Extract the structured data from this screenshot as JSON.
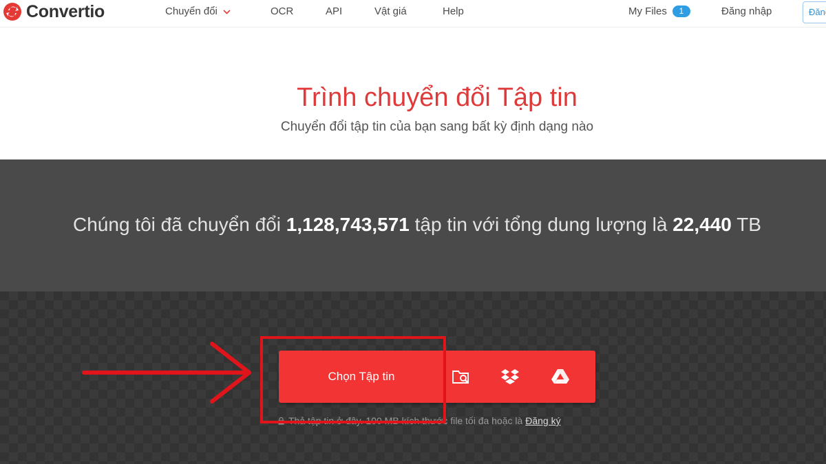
{
  "header": {
    "logo_text": "Convertio",
    "nav": [
      {
        "label": "Chuyển đổi",
        "has_dropdown": true
      },
      {
        "label": "OCR"
      },
      {
        "label": "API"
      },
      {
        "label": "Vật giá"
      },
      {
        "label": "Help"
      }
    ],
    "my_files_label": "My Files",
    "my_files_count": "1",
    "login_label": "Đăng nhập",
    "signup_label": "Đăng ký"
  },
  "hero": {
    "title": "Trình chuyển đổi Tập tin",
    "subtitle": "Chuyển đổi tập tin của bạn sang bất kỳ định dạng nào"
  },
  "stats": {
    "prefix": "Chúng tôi đã chuyển đổi",
    "files_count": "1,128,743,571",
    "middle": "tập tin với tổng dung lượng là",
    "total_size": "22,440",
    "unit": "TB"
  },
  "upload": {
    "choose_label": "Chọn Tập tin",
    "sources": [
      "folder-search-icon",
      "dropbox-icon",
      "google-drive-icon"
    ],
    "hint_text": "Thả tập tin ở đây. 100 MB kích thước file tối đa hoặc là",
    "hint_link": "Đăng ký"
  },
  "colors": {
    "brand_red": "#f23434",
    "title_red": "#e0393a",
    "stats_bg": "#4a4a4a",
    "upload_bg": "#333333",
    "badge_blue": "#2f9de4",
    "annotation_red": "#e0141b"
  }
}
